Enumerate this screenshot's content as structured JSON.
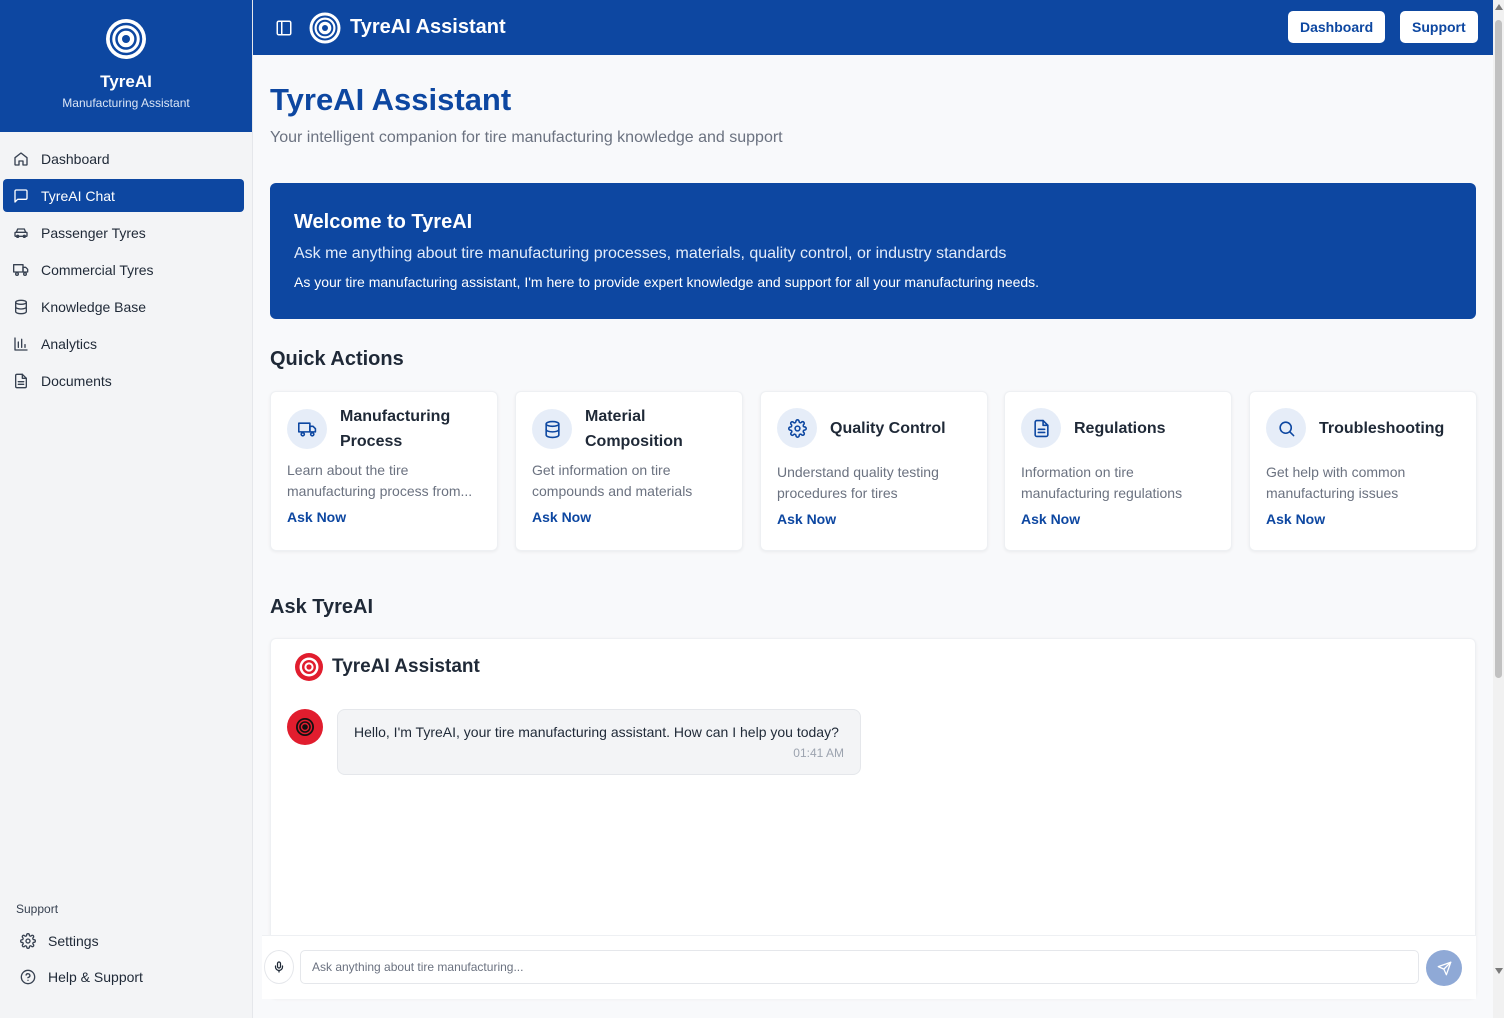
{
  "sidebar": {
    "brand_name": "TyreAI",
    "brand_sub": "Manufacturing Assistant",
    "items": [
      {
        "label": "Dashboard",
        "icon": "home-icon"
      },
      {
        "label": "TyreAI Chat",
        "icon": "message-square-icon",
        "active": true
      },
      {
        "label": "Passenger Tyres",
        "icon": "car-icon"
      },
      {
        "label": "Commercial Tyres",
        "icon": "truck-icon"
      },
      {
        "label": "Knowledge Base",
        "icon": "database-icon"
      },
      {
        "label": "Analytics",
        "icon": "bar-chart-icon"
      },
      {
        "label": "Documents",
        "icon": "file-text-icon"
      }
    ],
    "support_heading": "Support",
    "settings_label": "Settings",
    "help_label": "Help & Support"
  },
  "header": {
    "title": "TyreAI Assistant",
    "dashboard_button": "Dashboard",
    "support_button": "Support"
  },
  "main": {
    "title": "TyreAI Assistant",
    "subtitle": "Your intelligent companion for tire manufacturing knowledge and support"
  },
  "welcome": {
    "title": "Welcome to TyreAI",
    "line1": "Ask me anything about tire manufacturing processes, materials, quality control, or industry standards",
    "line2": "As your tire manufacturing assistant, I'm here to provide expert knowledge and support for all your manufacturing needs."
  },
  "quick_actions": {
    "heading": "Quick Actions",
    "cards": [
      {
        "title": "Manufacturing Process",
        "desc": "Learn about the tire manufacturing process from...",
        "action": "Ask Now",
        "icon": "truck-icon"
      },
      {
        "title": "Material Composition",
        "desc": "Get information on tire compounds and materials",
        "action": "Ask Now",
        "icon": "database-icon"
      },
      {
        "title": "Quality Control",
        "desc": "Understand quality testing procedures for tires",
        "action": "Ask Now",
        "icon": "gear-icon"
      },
      {
        "title": "Regulations",
        "desc": "Information on tire manufacturing regulations",
        "action": "Ask Now",
        "icon": "file-text-icon"
      },
      {
        "title": "Troubleshooting",
        "desc": "Get help with common manufacturing issues",
        "action": "Ask Now",
        "icon": "search-icon"
      }
    ]
  },
  "chat": {
    "heading": "Ask TyreAI",
    "title": "TyreAI Assistant",
    "messages": [
      {
        "text": "Hello, I'm TyreAI, your tire manufacturing assistant. How can I help you today?",
        "time": "01:41 AM"
      }
    ],
    "input_placeholder": "Ask anything about tire manufacturing...",
    "input_value": ""
  },
  "colors": {
    "primary": "#0d47a1",
    "accent_red": "#e11d2e",
    "background": "#f8f9fb"
  }
}
